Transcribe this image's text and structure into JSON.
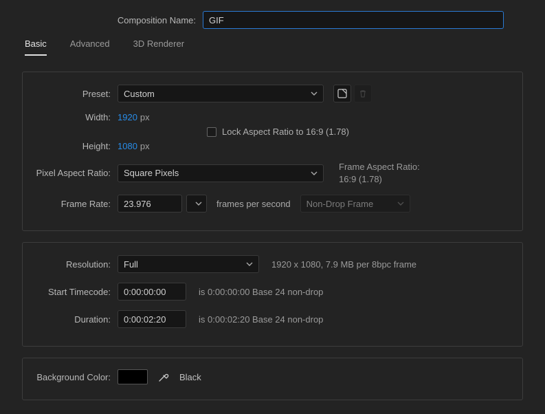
{
  "compName": {
    "label": "Composition Name:",
    "value": "GIF"
  },
  "tabs": {
    "basic": "Basic",
    "advanced": "Advanced",
    "renderer": "3D Renderer"
  },
  "preset": {
    "label": "Preset:",
    "value": "Custom"
  },
  "width": {
    "label": "Width:",
    "value": "1920",
    "unit": "px"
  },
  "height": {
    "label": "Height:",
    "value": "1080",
    "unit": "px"
  },
  "lock": {
    "label": "Lock Aspect Ratio to 16:9 (1.78)"
  },
  "par": {
    "label": "Pixel Aspect Ratio:",
    "value": "Square Pixels"
  },
  "far": {
    "label": "Frame Aspect Ratio:",
    "value": "16:9 (1.78)"
  },
  "frameRate": {
    "label": "Frame Rate:",
    "value": "23.976",
    "unit": "frames per second",
    "dropType": "Non-Drop Frame"
  },
  "resolution": {
    "label": "Resolution:",
    "value": "Full",
    "info": "1920 x 1080, 7.9 MB per 8bpc frame"
  },
  "startTC": {
    "label": "Start Timecode:",
    "value": "0:00:00:00",
    "info": "is 0:00:00:00  Base 24  non-drop"
  },
  "duration": {
    "label": "Duration:",
    "value": "0:00:02:20",
    "info": "is 0:00:02:20  Base 24  non-drop"
  },
  "bg": {
    "label": "Background Color:",
    "name": "Black",
    "hex": "#000000"
  }
}
